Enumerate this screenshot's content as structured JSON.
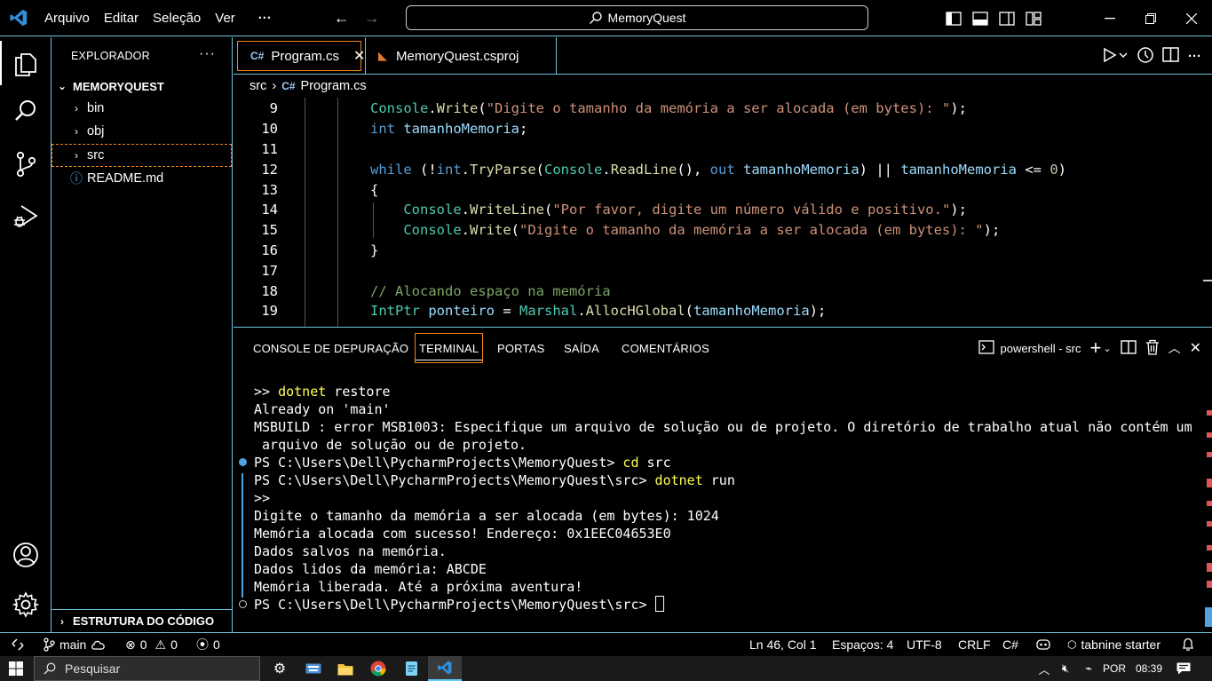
{
  "titlebar": {
    "menu": [
      "Arquivo",
      "Editar",
      "Seleção",
      "Ver"
    ],
    "more": "···",
    "search_text": "MemoryQuest"
  },
  "sidebar": {
    "header": "EXPLORADOR",
    "dots": "···",
    "root": "MEMORYQUEST",
    "items": [
      {
        "label": "bin",
        "type": "folder"
      },
      {
        "label": "obj",
        "type": "folder"
      },
      {
        "label": "src",
        "type": "folder"
      },
      {
        "label": "README.md",
        "type": "file"
      }
    ],
    "outline": "ESTRUTURA DO CÓDIGO"
  },
  "tabs": [
    {
      "icon": "C#",
      "label": "Program.cs",
      "close": "✕"
    },
    {
      "icon": "rss",
      "label": "MemoryQuest.csproj"
    }
  ],
  "breadcrumb": {
    "folder": "src",
    "sep": "›",
    "file": "Program.cs"
  },
  "code": {
    "line_numbers": [
      "9",
      "10",
      "11",
      "12",
      "13",
      "14",
      "15",
      "16",
      "17",
      "18",
      "19"
    ]
  },
  "panel": {
    "tabs": [
      "CONSOLE DE DEPURAÇÃO",
      "TERMINAL",
      "PORTAS",
      "SAÍDA",
      "COMENTÁRIOS"
    ],
    "terminal_name": "powershell - src",
    "terminal": [
      ">> dotnet restore",
      "Already on 'main'",
      "MSBUILD : error MSB1003: Especifique um arquivo de solução ou de projeto. O diretório de trabalho atual não contém um",
      " arquivo de solução ou de projeto.",
      "PS C:\\Users\\Dell\\PycharmProjects\\MemoryQuest> cd src",
      "PS C:\\Users\\Dell\\PycharmProjects\\MemoryQuest\\src> dotnet run",
      ">>",
      "Digite o tamanho da memória a ser alocada (em bytes): 1024",
      "Memória alocada com sucesso! Endereço: 0x1EEC04653E0",
      "Dados salvos na memória.",
      "Dados lidos da memória: ABCDE",
      "Memória liberada. Até a próxima aventura!",
      "PS C:\\Users\\Dell\\PycharmProjects\\MemoryQuest\\src> "
    ]
  },
  "status": {
    "branch": "main",
    "errors": "0",
    "warnings": "0",
    "ports": "0",
    "position": "Ln 46, Col 1",
    "spaces": "Espaços: 4",
    "encoding": "UTF-8",
    "eol": "CRLF",
    "language": "C#",
    "tabnine": "tabnine starter"
  },
  "taskbar": {
    "search_placeholder": "Pesquisar",
    "lang": "POR",
    "time": "08:39"
  },
  "colors": {
    "accent_border": "#6fc3df",
    "focus": "#f38518",
    "vscode_blue": "#2f8fdc"
  }
}
